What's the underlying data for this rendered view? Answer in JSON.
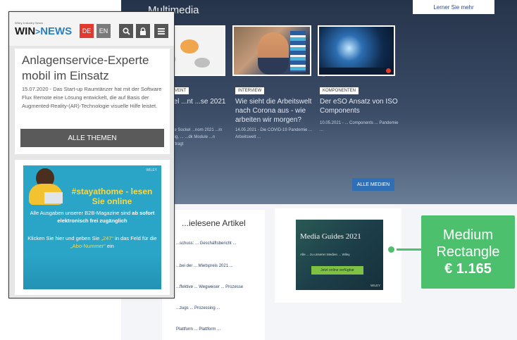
{
  "desktop": {
    "section_title": "Multimedia",
    "top_button": "Lerner Sie mehr",
    "cards": [
      {
        "tag": "EVENT",
        "head": "...iel ...nt ...se 2021",
        "body": "...ese Sockel ...nom 2021 ...in ...ndig, ... ...dk Module ...n ..Auftragt"
      },
      {
        "tag": "INTERVIEW",
        "head": "Wie sieht die Arbeitswelt nach Corona aus - wie arbeiten wir morgen?",
        "body": "14.05.2021 - Die COVID-19 Pandemie ... Arbeitswelt ..."
      },
      {
        "tag": "KOMPONENTEN",
        "head": "Der eSO Ansatz von ISO Components",
        "body": "10.05.2021 - ... Components ... Pandemie ..."
      }
    ],
    "more_button": "ALLE MEDIEN",
    "read_box_title": "...ielesene Artikel",
    "read_links": [
      "...schuss: ... Geschäftsbericht ...",
      "...bei der ... Mietspreis 2021 ...",
      "...ffektive ... Wegweiser ... Prozesse",
      "...zugs ... Prozessing ...",
      "Plattform ... Plattform ..."
    ],
    "media_ad": {
      "title": "Media Guides 2021",
      "subtitle": "Alle ... zu unseren Medien ... Wiley",
      "button": "Jetzt online verfügbar",
      "brand": "WILEY"
    },
    "callout": {
      "line1": "Medium",
      "line2": "Rectangle",
      "price": "€ 1.165",
      "color": "#4dc06e"
    }
  },
  "phone": {
    "logo_small": "Wiley Industry News",
    "logo_win": "WIN",
    "logo_chev": ">",
    "logo_news": "NEWS",
    "lang_de": "DE",
    "lang_en": "EN",
    "article": {
      "title": "Anlagenservice-Experte mobil im Einsatz",
      "text": "15.07.2020 - Das Start-up Raumtänzer hat mit der Software Flux Remote eine Lösung entwickelt, die auf Basis der Augmented-Reality-(AR)-Technologie visuelle Hilfe leistet."
    },
    "themes_button": "ALLE THEMEN",
    "ad": {
      "brand": "WILEY",
      "headline": "#stayathome - lesen Sie online",
      "p1_pre": "Alle Ausgaben unserer B2B-Magazine sind ",
      "p1_bold": "ab sofort elektronisch frei zugänglich",
      "p2_pre": "Klicken Sie hier und geben Sie ",
      "p2_hl1": "„247“",
      "p2_mid": " in das Feld für die ",
      "p2_hl2": "„Abo-Nummer“",
      "p2_post": " ein"
    }
  }
}
